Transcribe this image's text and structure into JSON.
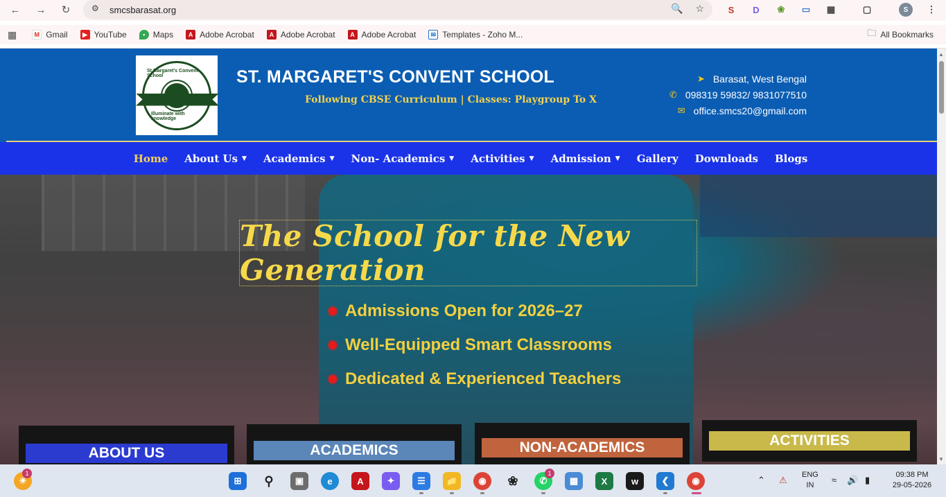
{
  "browser": {
    "url": "smcsbarasat.org",
    "bookmarks": [
      "Gmail",
      "YouTube",
      "Maps",
      "Adobe Acrobat",
      "Adobe Acrobat",
      "Adobe Acrobat",
      "Templates - Zoho M..."
    ],
    "all_bookmarks": "All Bookmarks",
    "profile_initial": "S"
  },
  "header": {
    "title": "ST. MARGARET'S CONVENT SCHOOL",
    "subtitle": "Following CBSE Curriculum | Classes: Playgroup To X",
    "logo_top_text": "St.Margaret's Convent School",
    "logo_bottom_text": "Illuminate with knowledge",
    "location": "Barasat, West Bengal",
    "phone": "098319 59832/ 9831077510",
    "email": "office.smcs20@gmail.com"
  },
  "nav": {
    "items": [
      {
        "label": "Home",
        "dropdown": false
      },
      {
        "label": "About Us",
        "dropdown": true
      },
      {
        "label": "Academics",
        "dropdown": true
      },
      {
        "label": "Non- Academics",
        "dropdown": true
      },
      {
        "label": "Activities",
        "dropdown": true
      },
      {
        "label": "Admission",
        "dropdown": true
      },
      {
        "label": "Gallery",
        "dropdown": false
      },
      {
        "label": "Downloads",
        "dropdown": false
      },
      {
        "label": "Blogs",
        "dropdown": false
      }
    ]
  },
  "hero": {
    "tagline": "The School for the New Generation",
    "bullets": [
      "Admissions Open for 2026–27",
      "Well-Equipped Smart Classrooms",
      "Dedicated & Experienced Teachers"
    ]
  },
  "cards": [
    {
      "label": "ABOUT US",
      "color": "#2b3bd0"
    },
    {
      "label": "ACADEMICS",
      "color": "#5b86b8"
    },
    {
      "label": "NON-ACADEMICS",
      "color": "#c0643e"
    },
    {
      "label": "ACTIVITIES",
      "color": "#c9b94a"
    }
  ],
  "taskbar": {
    "notif_badge": "1",
    "whatsapp_badge": "1",
    "lang_line1": "ENG",
    "lang_line2": "IN",
    "time": "09:38 PM",
    "date": "29-05-2026"
  },
  "colors": {
    "header_blue": "#0b5db3",
    "nav_blue": "#1a33e8",
    "accent_yellow": "#f3d24f"
  }
}
